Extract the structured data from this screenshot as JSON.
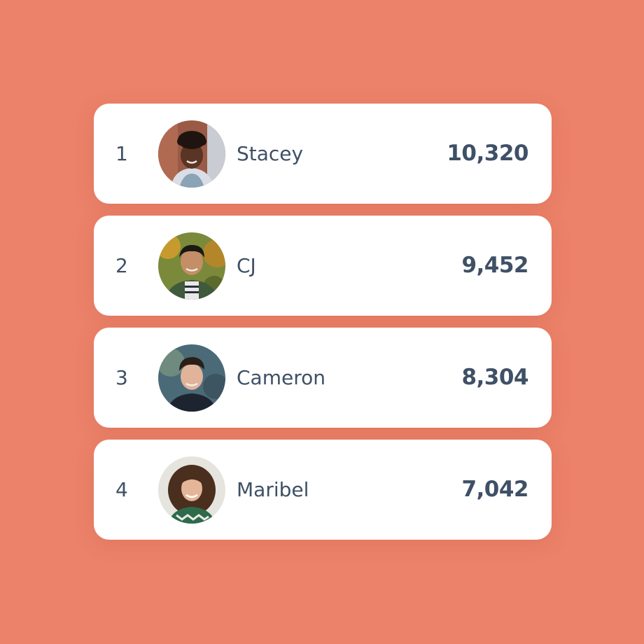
{
  "leaderboard": {
    "entries": [
      {
        "rank": "1",
        "name": "Stacey",
        "score": "10,320"
      },
      {
        "rank": "2",
        "name": "CJ",
        "score": "9,452"
      },
      {
        "rank": "3",
        "name": "Cameron",
        "score": "8,304"
      },
      {
        "rank": "4",
        "name": "Maribel",
        "score": "7,042"
      }
    ]
  },
  "colors": {
    "background": "#ec826a",
    "card": "#ffffff",
    "text": "#3f5066"
  }
}
